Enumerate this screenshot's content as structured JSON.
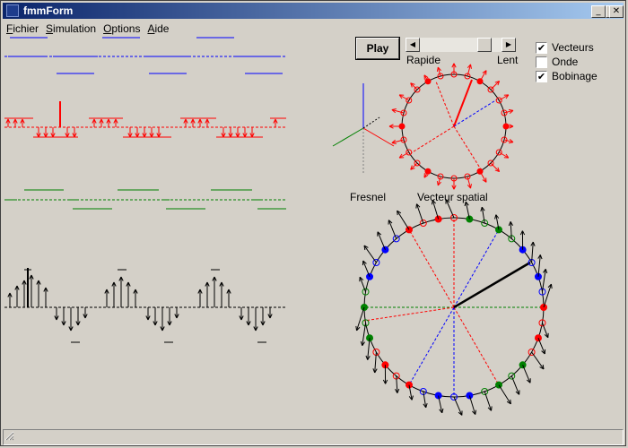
{
  "window": {
    "title": "fmmForm"
  },
  "caption_buttons": {
    "minimize": "_",
    "maximize": "□",
    "close": "✕"
  },
  "menu": [
    {
      "label": "Fichier"
    },
    {
      "label": "Simulation"
    },
    {
      "label": "Options"
    },
    {
      "label": "Aide"
    }
  ],
  "controls": {
    "play_label": "Play",
    "speed_fast_label": "Rapide",
    "speed_slow_label": "Lent",
    "speed_level": 0.85,
    "scroll_left": "◀",
    "scroll_right": "▶"
  },
  "checkboxes": [
    {
      "label": "Vecteurs",
      "checked": true,
      "mark": "✔"
    },
    {
      "label": "Onde",
      "checked": false,
      "mark": ""
    },
    {
      "label": "Bobinage",
      "checked": true,
      "mark": "✔"
    }
  ],
  "labels": {
    "fresnel": "Fresnel",
    "vecteur_spatial": "Vecteur spatial"
  },
  "colors": {
    "phase_a": "#ff0000",
    "phase_b": "#008000",
    "phase_c": "#0000ff",
    "resultant": "#000000",
    "titlebar_start": "#0a246a",
    "titlebar_end": "#a6caf0",
    "background": "#d4d0c8"
  },
  "icons": [
    "app-icon",
    "minimize-icon",
    "maximize-icon",
    "close-icon",
    "scroll-left-icon",
    "scroll-right-icon",
    "size-grip-icon"
  ]
}
